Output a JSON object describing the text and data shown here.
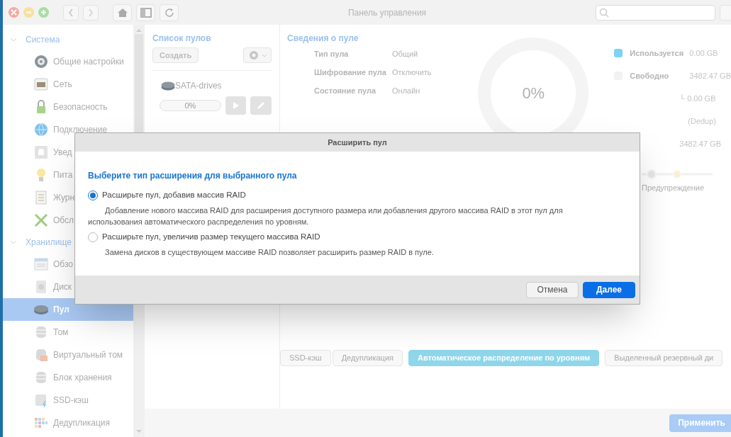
{
  "window": {
    "title": "Панель управления"
  },
  "sidebar": {
    "groups": [
      {
        "label": "Система",
        "expanded": true,
        "items": [
          {
            "label": "Общие настройки",
            "selected": false
          },
          {
            "label": "Сеть",
            "selected": false
          },
          {
            "label": "Безопасность",
            "selected": false
          },
          {
            "label": "Подключение",
            "selected": false
          },
          {
            "label": "Увед",
            "selected": false
          },
          {
            "label": "Пита",
            "selected": false
          },
          {
            "label": "Журн",
            "selected": false
          },
          {
            "label": "Обсл",
            "selected": false
          }
        ]
      },
      {
        "label": "Хранилище",
        "expanded": true,
        "items": [
          {
            "label": "Обзо",
            "selected": false
          },
          {
            "label": "Диск",
            "selected": false
          },
          {
            "label": "Пул",
            "selected": true
          },
          {
            "label": "Том",
            "selected": false
          },
          {
            "label": "Виртуальный том",
            "selected": false
          },
          {
            "label": "Блок хранения",
            "selected": false
          },
          {
            "label": "SSD-кэш",
            "selected": false
          },
          {
            "label": "Дедупликация",
            "selected": false
          }
        ]
      }
    ]
  },
  "pool_list": {
    "title": "Список пулов",
    "create_button": "Создать",
    "pools": [
      {
        "name": "SATA-drives",
        "level": 0,
        "reading": "0%"
      }
    ]
  },
  "pool_info": {
    "title": "Сведения о пуле",
    "fields": [
      {
        "label": "Тип пула",
        "value": "Общий"
      },
      {
        "label": "Шифрование пула",
        "value": "Отключить"
      },
      {
        "label": "Состояние пула",
        "value": "Онлайн"
      }
    ],
    "usage_reading": "0%",
    "legend": [
      {
        "label": "Используется",
        "value": "0.00 GB",
        "color": "#7dd3f7"
      },
      {
        "label": "Свободно",
        "value": "3482.47 GB",
        "color": "#f2f2f2"
      }
    ],
    "sub_lines": [
      "└ 0.00 GB",
      "(Dedup)",
      "3482.47 GB"
    ],
    "threshold": {
      "label": "Предупреждение",
      "level": 0.5
    }
  },
  "feature_tabs": [
    {
      "label": "SSD-кэш",
      "selected": false
    },
    {
      "label": "Дедупликация",
      "selected": false
    },
    {
      "label": "Автоматическое распределение по уровням",
      "selected": true
    },
    {
      "label": "Выделенный резервный ди",
      "selected": false
    }
  ],
  "apply_button": "Применить",
  "dialog": {
    "title": "Расширить пул",
    "heading": "Выберите тип расширения для выбранного пула",
    "options": [
      {
        "label": "Расширьте пул, добавив массив RAID",
        "description": "Добавление нового массива RAID для расширения доступного размера или добавления другого массива RAID в этот пул для использования автоматического распределения по уровням.",
        "selected": true
      },
      {
        "label": "Расширьте пул, увеличив размер текущего массива RAID",
        "description": "Замена дисков в существующем массиве RAID позволяет расширить размер RAID в пуле.",
        "selected": false
      }
    ],
    "buttons": [
      {
        "label": "Отмена",
        "kind": "secondary"
      },
      {
        "label": "Далее",
        "kind": "primary"
      }
    ]
  }
}
